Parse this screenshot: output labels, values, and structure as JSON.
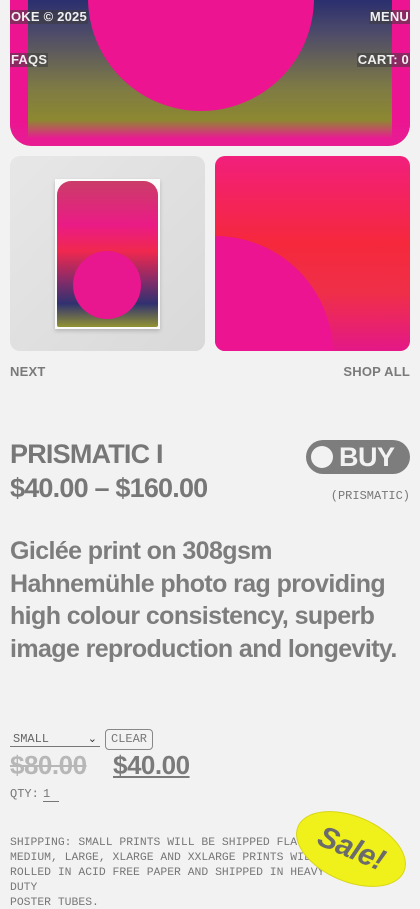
{
  "header": {
    "brand": "OKE © 2025",
    "menu_label": "MENU",
    "faqs_label": "FAQS",
    "cart_label": "CART: 0"
  },
  "gallery": {
    "next_label": "NEXT",
    "shop_all_label": "SHOP ALL"
  },
  "product": {
    "title": "PRISMATIC I",
    "price_range": "$40.00 – $160.00",
    "buy_label": "BUY",
    "collection_tag": "(PRISMATIC)",
    "description": "Giclée print on 308gsm Hahnemühle photo rag providing high colour consistency, superb image reproduction and longevity."
  },
  "options": {
    "size_selected": "SMALL",
    "clear_label": "CLEAR",
    "old_price": "$80.00",
    "new_price": "$40.00",
    "qty_label": "QTY:",
    "qty_value": "1"
  },
  "shipping_note": "SHIPPING: SMALL PRINTS WILL BE SHIPPED FLAT.\nMEDIUM, LARGE, XLARGE AND XXLARGE PRINTS WILL BE\nROLLED IN ACID FREE PAPER AND SHIPPED IN HEAVY-DUTY\nPOSTER TUBES.",
  "sale_badge": "Sale!",
  "colors": {
    "magenta": "#ec1490",
    "navy": "#2a2f6e",
    "olive": "#8e8a2e",
    "sale_yellow": "#f0f01a",
    "text_grey": "#777777"
  }
}
